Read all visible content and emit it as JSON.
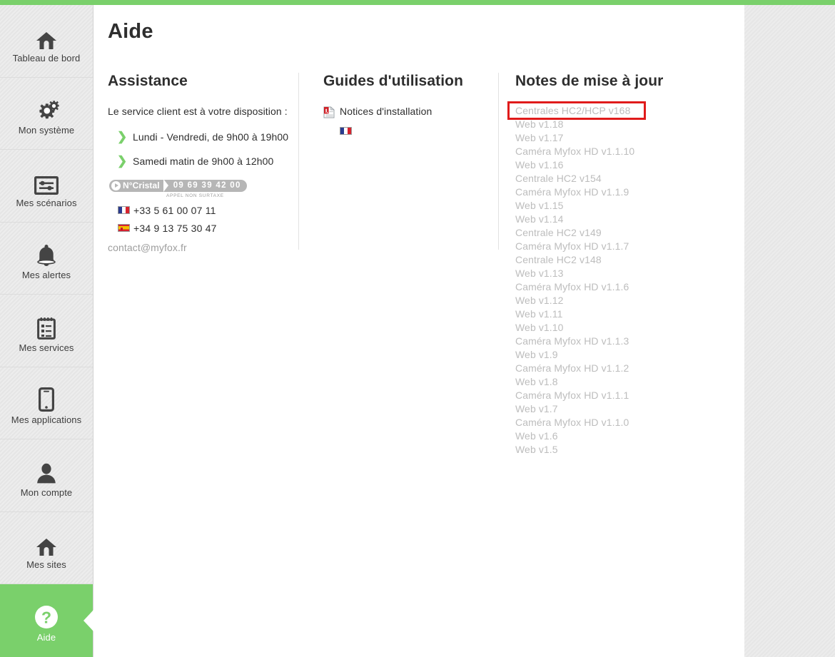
{
  "theme": {
    "accent_green": "#7ad06b",
    "highlight_red": "#e01b1b",
    "text_dark": "#2e2e2e",
    "text_muted": "#bdbdbd"
  },
  "sidebar": {
    "items": [
      {
        "label": "Tableau de bord",
        "icon": "home-icon",
        "active": false
      },
      {
        "label": "Mon système",
        "icon": "gears-icon",
        "active": false
      },
      {
        "label": "Mes scénarios",
        "icon": "sliders-icon",
        "active": false
      },
      {
        "label": "Mes alertes",
        "icon": "bell-icon",
        "active": false
      },
      {
        "label": "Mes services",
        "icon": "clipboard-icon",
        "active": false
      },
      {
        "label": "Mes applications",
        "icon": "smartphone-icon",
        "active": false
      },
      {
        "label": "Mon compte",
        "icon": "user-icon",
        "active": false
      },
      {
        "label": "Mes sites",
        "icon": "home-icon",
        "active": false
      },
      {
        "label": "Aide",
        "icon": "question-icon",
        "active": true
      }
    ]
  },
  "page": {
    "title": "Aide"
  },
  "assistance": {
    "heading": "Assistance",
    "intro": "Le service client est à votre disposition :",
    "hours": [
      "Lundi - Vendredi, de 9h00 à 19h00",
      "Samedi matin de 9h00 à 12h00"
    ],
    "cristal": {
      "name": "N°Cristal",
      "number": "09 69 39 42 00",
      "note": "APPEL NON SURTAXE"
    },
    "phones": [
      {
        "country": "fr",
        "number": "+33 5 61 00 07 11"
      },
      {
        "country": "es",
        "number": "+34 9 13 75 30 47"
      }
    ],
    "email": "contact@myfox.fr"
  },
  "guides": {
    "heading": "Guides d'utilisation",
    "items": [
      {
        "label": "Notices d'installation",
        "icon": "pdf-icon",
        "flag": "fr"
      }
    ]
  },
  "notes": {
    "heading": "Notes de mise à jour",
    "items": [
      "Centrales HC2/HCP v168",
      "Web v1.18",
      "Web v1.17",
      "Caméra Myfox HD v1.1.10",
      "Web v1.16",
      "Centrale HC2 v154",
      "Caméra Myfox HD v1.1.9",
      "Web v1.15",
      "Web v1.14",
      "Centrale HC2 v149",
      "Caméra Myfox HD v1.1.7",
      "Centrale HC2 v148",
      "Web v1.13",
      "Caméra Myfox HD v1.1.6",
      "Web v1.12",
      "Web v1.11",
      "Web v1.10",
      "Caméra Myfox HD v1.1.3",
      "Web v1.9",
      "Caméra Myfox HD v1.1.2",
      "Web v1.8",
      "Caméra Myfox HD v1.1.1",
      "Web v1.7",
      "Caméra Myfox HD v1.1.0",
      "Web v1.6",
      "Web v1.5"
    ],
    "highlighted_index": 0
  }
}
